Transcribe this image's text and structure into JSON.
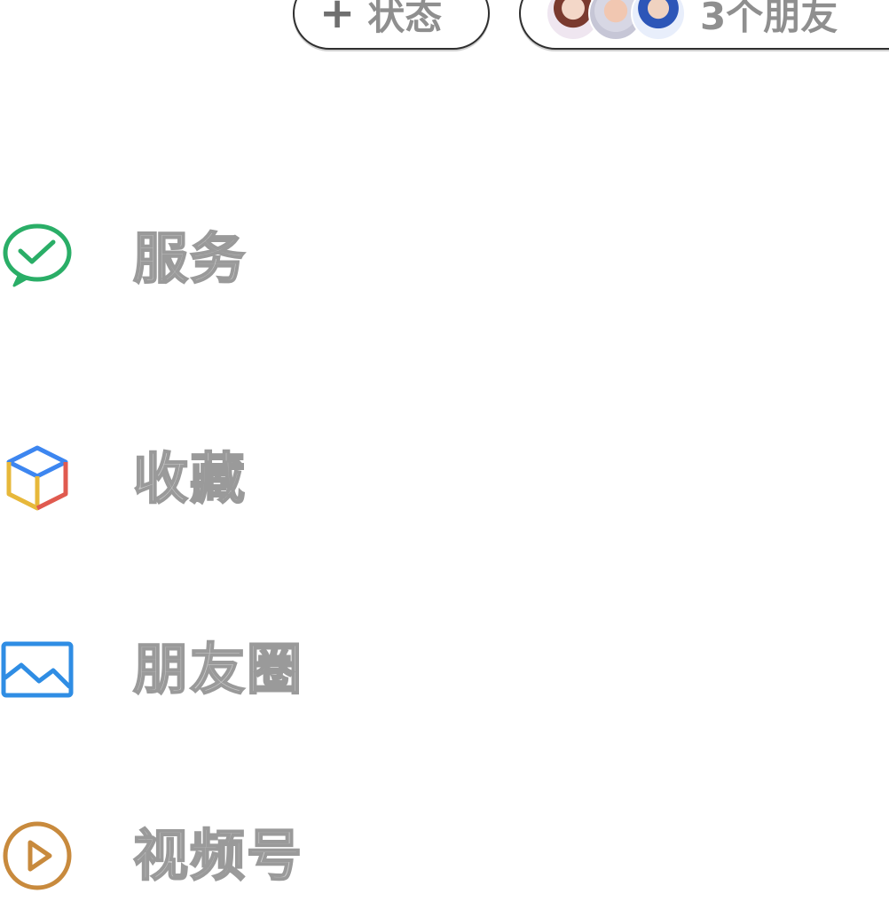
{
  "header": {
    "status_button": {
      "icon": "plus-icon",
      "label": "状态"
    },
    "friends_button": {
      "avatars": [
        "friend-avatar-1",
        "friend-avatar-2",
        "friend-avatar-3"
      ],
      "label": "3个朋友"
    }
  },
  "menu": {
    "items": [
      {
        "icon": "wechat-pay-check-icon",
        "label": "服务",
        "icon_color": "#2aae67"
      },
      {
        "icon": "favorites-cube-icon",
        "label": "收藏",
        "icon_colors": [
          "#3d86f0",
          "#e7b83a",
          "#e05a4f"
        ]
      },
      {
        "icon": "moments-photo-icon",
        "label": "朋友圈",
        "icon_color": "#2f8de4"
      },
      {
        "icon": "channels-play-icon",
        "label": "视频号",
        "icon_color": "#c88a3d"
      }
    ]
  }
}
